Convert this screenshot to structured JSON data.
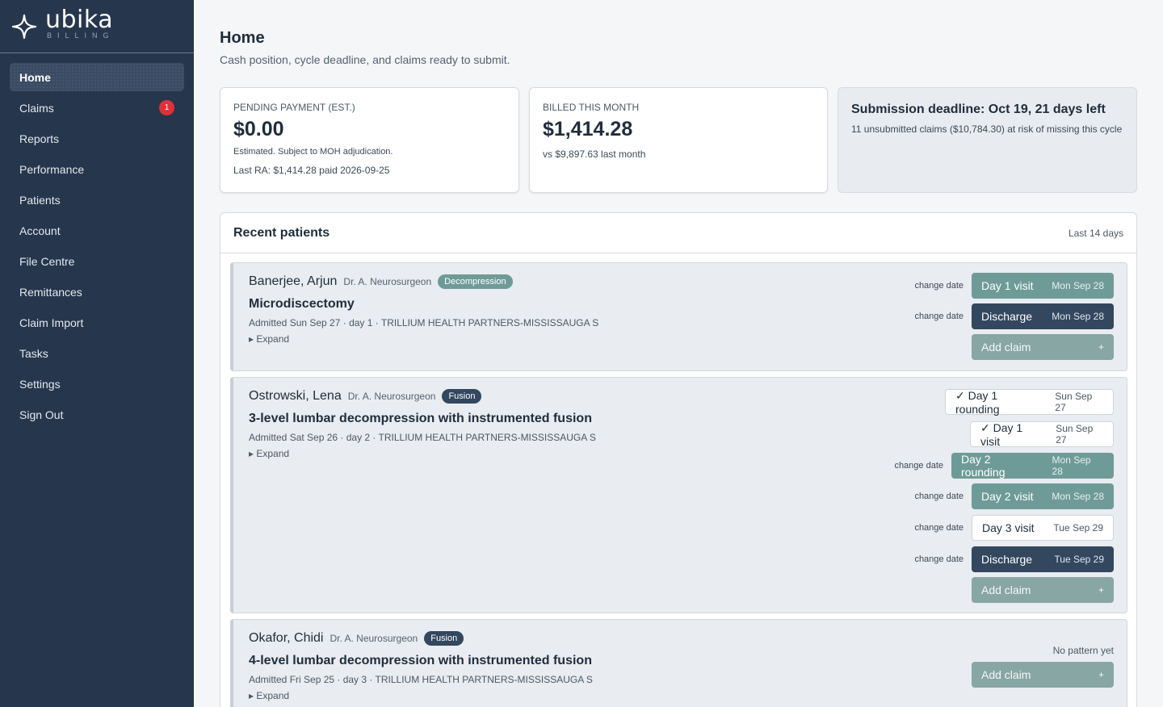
{
  "brand": {
    "name": "ubika",
    "sub": "BILLING"
  },
  "nav": {
    "items": [
      {
        "label": "Home",
        "active": true
      },
      {
        "label": "Claims",
        "badge": "1"
      },
      {
        "label": "Reports"
      },
      {
        "label": "Performance"
      },
      {
        "label": "Patients"
      },
      {
        "label": "Account"
      },
      {
        "label": "File Centre"
      },
      {
        "label": "Remittances"
      },
      {
        "label": "Claim Import"
      },
      {
        "label": "Tasks"
      },
      {
        "label": "Settings"
      },
      {
        "label": "Sign Out"
      }
    ]
  },
  "page": {
    "title": "Home",
    "subtitle": "Cash position, cycle deadline, and claims ready to submit."
  },
  "cards": {
    "pending": {
      "label": "Pending payment (est.)",
      "value": "$0.00",
      "note": "Estimated. Subject to MOH adjudication.",
      "last_ra": "Last RA: $1,414.28 paid 2026-09-25"
    },
    "billed": {
      "label": "Billed this month",
      "value": "$1,414.28",
      "note": "vs $9,897.63 last month"
    },
    "deadline": {
      "title": "Submission deadline: Oct 19, 21 days left",
      "text": "11 unsubmitted claims ($10,784.30) at risk of missing this cycle"
    }
  },
  "recent": {
    "title": "Recent patients",
    "range": "Last 14 days",
    "change_date_label": "change date",
    "expand_label": "▸ Expand",
    "add_claim_label": "Add claim",
    "add_claim_icon": "+",
    "patients": [
      {
        "name": "Banerjee, Arjun",
        "doctor": "Dr. A. Neurosurgeon",
        "tag": "Decompression",
        "procedure": "Microdiscectomy",
        "admitted": "Admitted Sun Sep 27 · day 1 · TRILLIUM HEALTH PARTNERS-MISSISSAUGA S",
        "actions": [
          {
            "label": "Day 1 visit",
            "date": "Mon Sep 28"
          },
          {
            "label": "Discharge",
            "date": "Mon Sep 28"
          }
        ]
      },
      {
        "name": "Ostrowski, Lena",
        "doctor": "Dr. A. Neurosurgeon",
        "tag": "Fusion",
        "procedure": "3-level lumbar decompression with instrumented fusion",
        "admitted": "Admitted Sat Sep 26 · day 2 · TRILLIUM HEALTH PARTNERS-MISSISSAUGA S",
        "actions": [
          {
            "label": "✓ Day 1 rounding",
            "date": "Sun Sep 27"
          },
          {
            "label": "✓ Day 1 visit",
            "date": "Sun Sep 27"
          },
          {
            "label": "Day 2 rounding",
            "date": "Mon Sep 28"
          },
          {
            "label": "Day 2 visit",
            "date": "Mon Sep 28"
          },
          {
            "label": "Day 3 visit",
            "date": "Tue Sep 29"
          },
          {
            "label": "Discharge",
            "date": "Tue Sep 29"
          }
        ]
      },
      {
        "name": "Okafor, Chidi",
        "doctor": "Dr. A. Neurosurgeon",
        "tag": "Fusion",
        "procedure": "4-level lumbar decompression with instrumented fusion",
        "admitted": "Admitted Fri Sep 25 · day 3 · TRILLIUM HEALTH PARTNERS-MISSISSAUGA S",
        "no_pattern": "No pattern yet"
      }
    ]
  },
  "colors": {
    "sidebar": "#26364d",
    "teal": "#6e9b98",
    "navy": "#33475f",
    "alert": "#e0313a"
  }
}
